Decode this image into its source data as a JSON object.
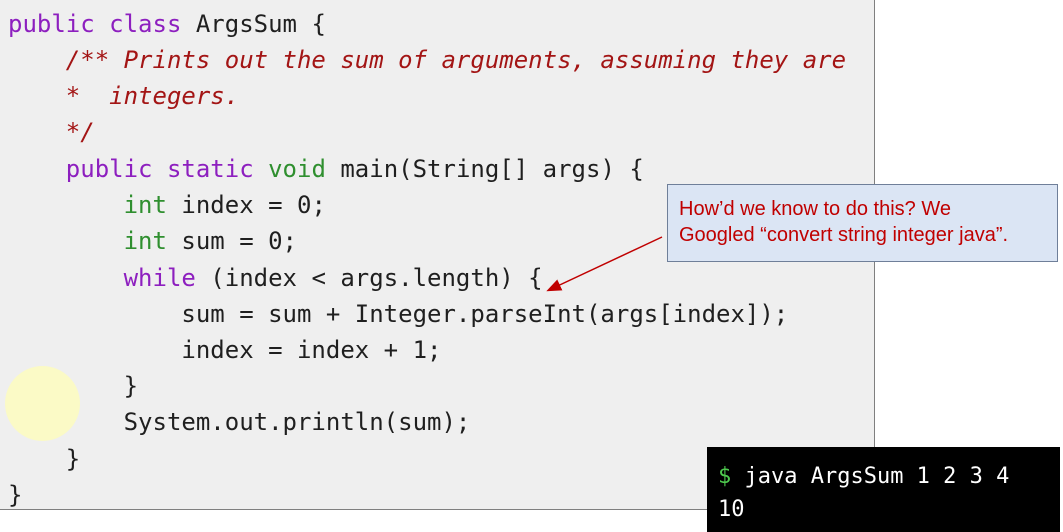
{
  "code": {
    "class_decl": {
      "kw1": "public",
      "kw2": "class",
      "name": "ArgsSum",
      "brace": "{"
    },
    "doc_line1": "/** Prints out the sum of arguments, assuming they are",
    "doc_line2": "*  integers.",
    "doc_line3": "*/",
    "method_decl": {
      "kw1": "public",
      "kw2": "static",
      "ret": "void",
      "rest": "main(String[] args) {"
    },
    "decl_index": {
      "type": "int",
      "rest": "index = 0;"
    },
    "decl_sum": {
      "type": "int",
      "rest": "sum = 0;"
    },
    "while_line": {
      "kw": "while",
      "rest": "(index < args.length) {"
    },
    "sum_line": "sum = sum + Integer.parseInt(args[index]);",
    "index_line": "index = index + 1;",
    "while_close": "}",
    "println_line": "System.out.println(sum);",
    "method_close": "}",
    "class_close": "}"
  },
  "callout": {
    "text_line1": "How’d we know to do this? We",
    "text_line2": "Googled “convert string integer java”."
  },
  "terminal": {
    "prompt": "$",
    "command": "java ArgsSum 1 2 3 4",
    "output": "10"
  },
  "colors": {
    "keyword": "#8d1fbf",
    "type": "#2f8f2f",
    "comment": "#a31515",
    "callout_text": "#c00000",
    "callout_bg": "#dbe5f4",
    "terminal_prompt": "#4ec94e"
  }
}
